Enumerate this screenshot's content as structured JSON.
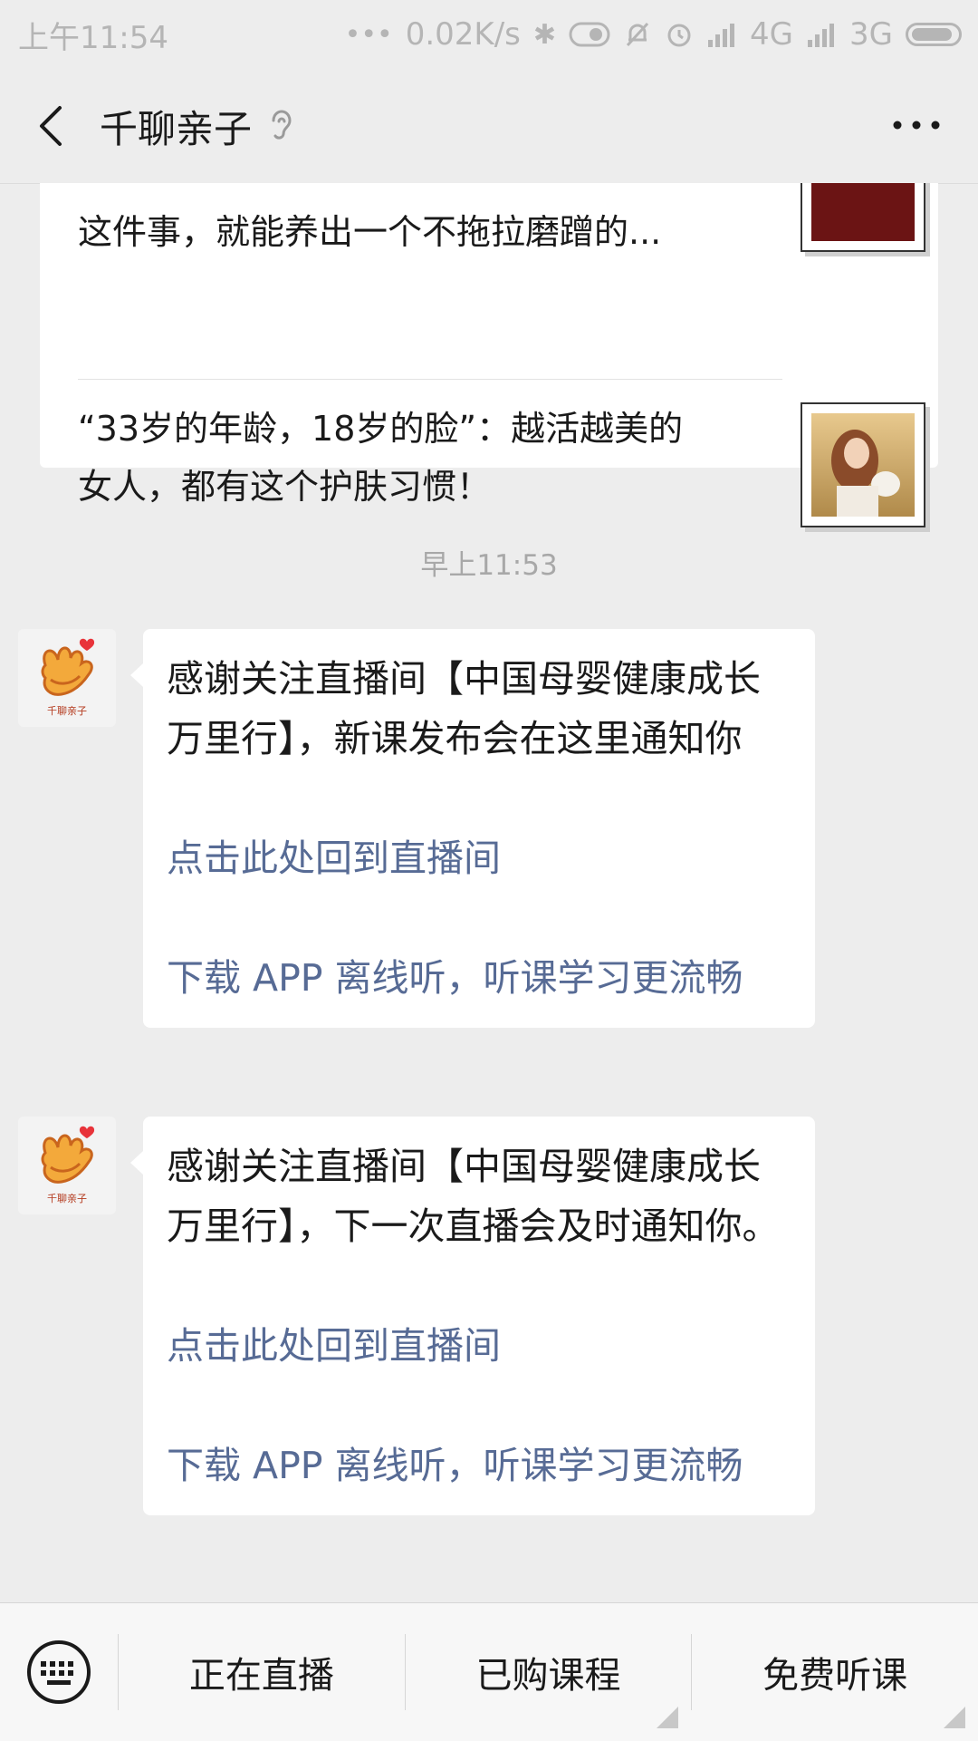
{
  "status_bar": {
    "time": "上午11:54",
    "network_speed": "0.02K/s",
    "signal1": "4G",
    "signal2": "3G",
    "icons": [
      "dots-icon",
      "bluetooth-icon",
      "toggle-icon",
      "mute-bell-icon",
      "alarm-icon",
      "hd-signal-icon",
      "signal-icon",
      "battery-icon"
    ]
  },
  "header": {
    "title": "千聊亲子",
    "back_icon": "chevron-left-icon",
    "listen_icon": "ear-icon",
    "more_icon": "more-dots-icon"
  },
  "articles": [
    {
      "title": "这件事，就能养出一个不拖拉磨蹭的..."
    },
    {
      "title": "“33岁的年龄，18岁的脸”：越活越美的女人，都有这个护肤习惯！"
    }
  ],
  "timestamp": "早上11:53",
  "avatar_label": "千聊亲子",
  "messages": [
    {
      "text": "感谢关注直播间【中国母婴健康成长万里行】，新课发布会在这里通知你",
      "link1": "点击此处回到直播间",
      "link2": "下载 APP 离线听，听课学习更流畅"
    },
    {
      "text": "感谢关注直播间【中国母婴健康成长万里行】，下一次直播会及时通知你。",
      "link1": "点击此处回到直播间",
      "link2": "下载 APP 离线听，听课学习更流畅"
    }
  ],
  "menu": {
    "keyboard_icon": "keyboard-icon",
    "items": [
      "正在直播",
      "已购课程",
      "免费听课"
    ]
  },
  "colors": {
    "background": "#ededed",
    "link": "#576b95",
    "bubble": "#ffffff",
    "avatar_accent": "#f3a93b"
  }
}
